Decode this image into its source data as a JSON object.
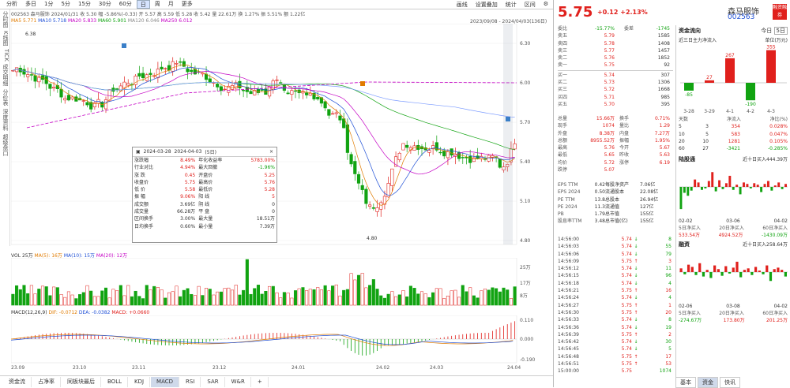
{
  "menu": {
    "items": [
      "分析",
      "多日",
      "1分",
      "5分",
      "15分",
      "30分",
      "60分",
      "日",
      "周",
      "月",
      "更多"
    ],
    "active": "日"
  },
  "top_icons": {
    "i1": "画线",
    "i2": "设置叠加",
    "i3": "统计",
    "i4": "区间",
    "i5": "标记"
  },
  "top_links": [
    "画线",
    "设置叠加",
    "统计",
    "区间"
  ],
  "left_tabs": [
    "分时图",
    "K线图",
    "TICK",
    "成交明细",
    "分价表",
    "深度资料",
    "超级盘口"
  ],
  "info": "002563 森马服饰  2024/01/31  收 5.30  幅 -5.86%(-0.33)  开 5.57  高 5.59  低 5.28  收 5.42  量 22.61万  换 1.27%  振 5.51%  额 1.22亿",
  "ma_line": {
    "ma5": "MA5 5.771",
    "ma10": "MA10 5.718",
    "ma20": "MA20 5.833",
    "ma60": "MA60 5.901",
    "ma120": "MA120 6.046",
    "ma250": "MA250 6.012"
  },
  "date_range": "2023/09/08 - 2024/04/03(136日)",
  "price_axis": [
    "6.30",
    "6.00",
    "5.70",
    "5.40",
    "5.10",
    "4.80"
  ],
  "price_marks": {
    "high": "6.38",
    "low": "4.80"
  },
  "vol_line": {
    "vol": "VOL 25万",
    "ma5": "MA(5): 16万",
    "ma10": "MA(10): 15万",
    "ma20": "MA(20): 12万"
  },
  "vol_axis": [
    "25万",
    "17万",
    "8万"
  ],
  "macd_line": {
    "label": "MACD(12,26,9)",
    "dif": "DIF: -0.0712",
    "dea": "DEA: -0.0382",
    "macd": "MACD: +0.0660"
  },
  "macd_axis": [
    "0.110",
    "0.000",
    "-0.190"
  ],
  "x_axis": [
    "23.09",
    "23.10",
    "23.11",
    "23.12",
    "24.01",
    "24.02",
    "24.03",
    "24.04"
  ],
  "bottom_tabs": [
    "资金流",
    "占净率",
    "同板块最后",
    "BOLL",
    "KDJ",
    "MACD",
    "RSI",
    "SAR",
    "W&R",
    "+"
  ],
  "bottom_active": "MACD",
  "popup": {
    "from": "2024-03-28",
    "to": "2024-04-03",
    "days": "(5日)",
    "rows": [
      [
        "涨跌幅",
        "8.49%",
        "年化收益率",
        "5783.00%"
      ],
      [
        "行业对比",
        "4.94%",
        "最大回撤",
        "-1.96%"
      ],
      [
        "涨 跌",
        "0.45",
        "开盘价",
        "5.25"
      ],
      [
        "收盘价",
        "5.75",
        "最高价",
        "5.76"
      ],
      [
        "低 价",
        "5.58",
        "最低价",
        "5.28"
      ],
      [
        "振 幅",
        "9.06%",
        "阳 线",
        "5"
      ],
      [
        "成交额",
        "3.69亿",
        "阴 线",
        "0"
      ],
      [
        "成交量",
        "66.28万",
        "平 盘",
        "0"
      ],
      [
        "区间换手",
        "3.00%",
        "最大量",
        "18.51万"
      ],
      [
        "日均换手",
        "0.60%",
        "最小量",
        "7.39万"
      ]
    ]
  },
  "quote": {
    "price": "5.75",
    "change": "+0.12",
    "pct": "+2.13%",
    "name": "森马服饰",
    "code": "002563",
    "tag": "融资融券",
    "wei": [
      "委比",
      "-15.77%",
      "委差",
      "-1745"
    ],
    "asks": [
      [
        "卖五",
        "5.79",
        "1585"
      ],
      [
        "卖四",
        "5.78",
        "1408"
      ],
      [
        "卖三",
        "5.77",
        "1457"
      ],
      [
        "卖二",
        "5.76",
        "1852"
      ],
      [
        "卖一",
        "5.75",
        "92"
      ]
    ],
    "bids": [
      [
        "买一",
        "5.74",
        "307"
      ],
      [
        "买二",
        "5.73",
        "1306"
      ],
      [
        "买三",
        "5.72",
        "1668"
      ],
      [
        "买四",
        "5.71",
        "985"
      ],
      [
        "买五",
        "5.70",
        "395"
      ]
    ],
    "stats": [
      [
        "总量",
        "15.66万",
        "换手",
        "0.71%"
      ],
      [
        "现手",
        "1074",
        "量比",
        "1.29"
      ],
      [
        "外盘",
        "8.38万",
        "内盘",
        "7.27万"
      ],
      [
        "总额",
        "8955.52万",
        "振幅",
        "1.95%"
      ],
      [
        "最高",
        "5.76",
        "今开",
        "5.67"
      ],
      [
        "最低",
        "5.65",
        "昨收",
        "5.63"
      ],
      [
        "均价",
        "5.72",
        "涨停",
        "6.19"
      ],
      [
        "跌停",
        "5.07",
        "",
        ""
      ]
    ],
    "fin": [
      [
        "EPS TTM",
        "0.42",
        "每股净资产",
        "7.06亿"
      ],
      [
        "EPS 2024",
        "0.50",
        "流通股本",
        "22.08亿"
      ],
      [
        "PE TTM",
        "13.8",
        "总股本",
        "26.94亿"
      ],
      [
        "PE 2024",
        "11.3",
        "流通值",
        "127亿"
      ],
      [
        "PB",
        "1.79",
        "总市值",
        "155亿"
      ],
      [
        "股息率TTM",
        "3.48",
        "总市值(亿)",
        "155亿"
      ]
    ],
    "ticks": [
      [
        "14:56:00",
        "5.74",
        "↓",
        "8"
      ],
      [
        "14:56:03",
        "5.74",
        "↓",
        "55"
      ],
      [
        "14:56:06",
        "5.74",
        "↓",
        "79"
      ],
      [
        "14:56:09",
        "5.75",
        "↑",
        "3"
      ],
      [
        "14:56:12",
        "5.74",
        "↓",
        "11"
      ],
      [
        "14:56:15",
        "5.74",
        "↓",
        "96"
      ],
      [
        "14:56:18",
        "5.74",
        "↓",
        "4"
      ],
      [
        "14:56:21",
        "5.75",
        "↑",
        "16"
      ],
      [
        "14:56:24",
        "5.74",
        "↓",
        "4"
      ],
      [
        "14:56:27",
        "5.75",
        "↑",
        "1"
      ],
      [
        "14:56:30",
        "5.75",
        "↑",
        "20"
      ],
      [
        "14:56:33",
        "5.74",
        "↓",
        "8"
      ],
      [
        "14:56:36",
        "5.74",
        "↓",
        "19"
      ],
      [
        "14:56:39",
        "5.75",
        "↑",
        "2"
      ],
      [
        "14:56:42",
        "5.74",
        "↓",
        "30"
      ],
      [
        "14:56:45",
        "5.74",
        "↓",
        "5"
      ],
      [
        "14:56:48",
        "5.75",
        "↑",
        "17"
      ],
      [
        "14:56:51",
        "5.75",
        "↑",
        "53"
      ],
      [
        "15:00:00",
        "5.75",
        "",
        "1074"
      ]
    ]
  },
  "fund": {
    "title": "资金流向",
    "t_label": "今日",
    "t_label2": "5日",
    "sub": "近三日主力净流入",
    "unit": "单位(万元)",
    "bars_values": [
      -85,
      27,
      267,
      -190,
      355
    ],
    "bars_labels": [
      "-85",
      "27",
      "267",
      "-190",
      "355"
    ],
    "bar_dates": [
      "3-28",
      "3-29",
      "4-1",
      "4-2",
      "4-3"
    ],
    "table_head": [
      "天数",
      "净流入",
      "净比(%)"
    ],
    "table_cols": [
      "天数",
      "净流入",
      "净比",
      "净流入2",
      "净比2"
    ],
    "table": [
      [
        "5",
        "3",
        "354",
        "0.028%"
      ],
      [
        "10",
        "5",
        "583",
        "0.047%"
      ],
      [
        "20",
        "10",
        "1281",
        "0.105%"
      ],
      [
        "60",
        "27",
        "-3421",
        "-0.285%"
      ]
    ],
    "north_title": "陆股通",
    "north_sub": "近十日买入444.39万",
    "north_dates": [
      "02-02",
      "03-06",
      "04-02"
    ],
    "north_values": [
      -30,
      -8,
      -12,
      -5,
      10,
      6,
      -4,
      -2,
      8,
      20,
      -6,
      9,
      -3,
      5,
      15,
      -4,
      3,
      -10,
      6,
      4,
      -2,
      5,
      3,
      -7,
      4,
      8,
      -5,
      2,
      6,
      -3,
      4
    ],
    "north_foot": [
      "5日净买入",
      "20日净买入",
      "60日净买入"
    ],
    "north_foot_vals": [
      "533.54万",
      "4924.52万",
      "-1430.09万"
    ],
    "margin_title": "融资",
    "margin_sub": "近十日买入258.64万",
    "margin_dates": [
      "02-06",
      "03-08",
      "04-02"
    ],
    "margin_values": [
      5,
      -3,
      10,
      7,
      -4,
      12,
      -6,
      3,
      -8,
      9,
      4,
      -5,
      8,
      -2,
      6,
      14,
      -7,
      3,
      5,
      -4,
      7,
      2,
      -3,
      9,
      -12,
      4,
      6,
      3,
      -6
    ],
    "margin_foot_vals": [
      "-274.67万",
      "173.80万",
      "201.25万"
    ],
    "side_tabs": [
      "基本",
      "资金",
      "快讯"
    ]
  }
}
